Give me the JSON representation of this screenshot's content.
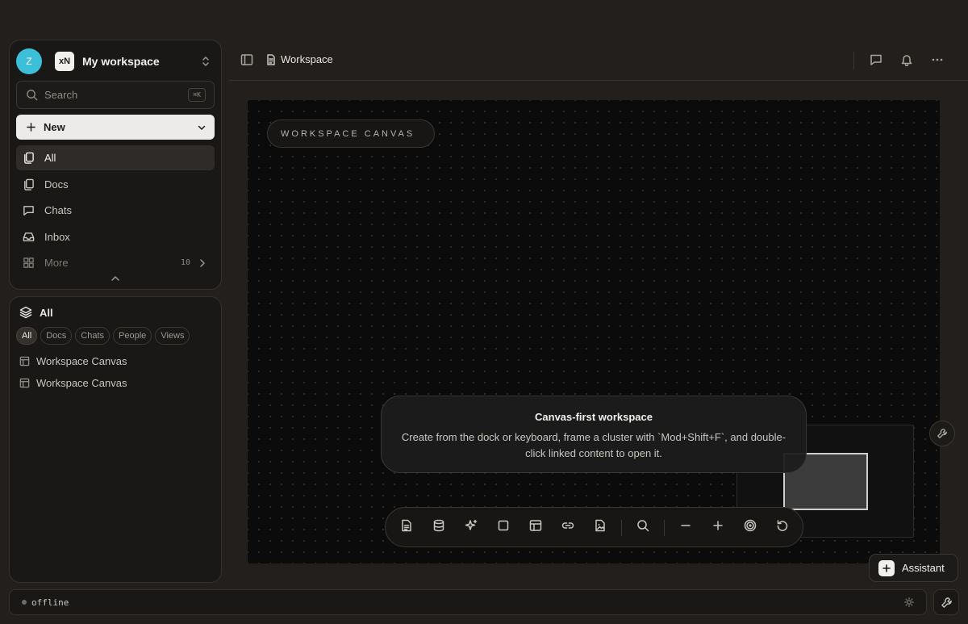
{
  "user": {
    "avatar_initial": "Z",
    "avatar_color": "#3cbfd9"
  },
  "workspace": {
    "logo_text": "xN",
    "name": "My workspace"
  },
  "search": {
    "placeholder": "Search",
    "shortcut": "⌘K"
  },
  "new_button": {
    "label": "New"
  },
  "nav": {
    "items": [
      {
        "label": "All",
        "icon": "files-icon",
        "active": true
      },
      {
        "label": "Docs",
        "icon": "docs-icon"
      },
      {
        "label": "Chats",
        "icon": "chat-icon"
      },
      {
        "label": "Inbox",
        "icon": "inbox-icon"
      }
    ],
    "more": {
      "label": "More",
      "count": "10"
    }
  },
  "library": {
    "title": "All",
    "filters": [
      "All",
      "Docs",
      "Chats",
      "People",
      "Views"
    ],
    "active_filter": "All",
    "items": [
      {
        "label": "Workspace Canvas",
        "icon": "table-icon"
      },
      {
        "label": "Workspace Canvas",
        "icon": "table-icon"
      }
    ]
  },
  "header": {
    "breadcrumb": "Workspace"
  },
  "canvas": {
    "badge": "WORKSPACE CANVAS",
    "hint_title": "Canvas-first workspace",
    "hint_body": "Create from the dock or keyboard, frame a cluster with `Mod+Shift+F`, and double-click linked content to open it."
  },
  "dock": {
    "tools": [
      "doc-icon",
      "database-icon",
      "sparkle-icon",
      "square-icon",
      "table-icon",
      "link-icon",
      "image-file-icon",
      "search-icon",
      "minus-icon",
      "plus-icon",
      "target-icon",
      "reset-icon"
    ]
  },
  "assistant": {
    "label": "Assistant"
  },
  "status": {
    "text": "offline"
  },
  "colors": {
    "background": "#221f1c",
    "panel": "#191816",
    "canvas": "#0b0b0b",
    "accent_avatar": "#3cbfd9"
  }
}
